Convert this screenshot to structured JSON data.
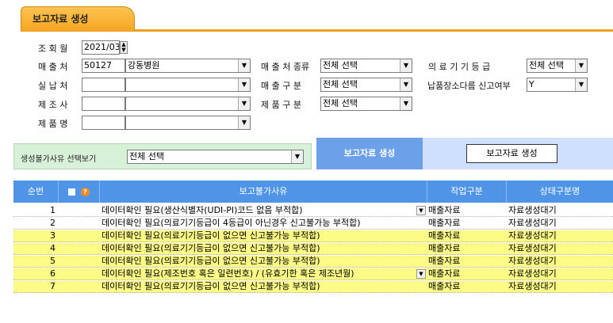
{
  "tab": {
    "title": "보고자료 생성"
  },
  "filters": {
    "period_label": "조 회 월",
    "period_value": "2021/03",
    "sales_label": "매 출 처",
    "sales_code": "50127",
    "sales_name": "강동병원",
    "sales_type_label": "매 출 처 종류",
    "sales_type_value": "전체 선택",
    "device_grade_label": "의 료 기 기 등 급",
    "device_grade_value": "전체 선택",
    "payer_label": "실 납 처",
    "payer_code": "",
    "payer_name": "",
    "sales_div_label": "매 출 구 분",
    "sales_div_value": "전체 선택",
    "report_flag_label": "납품장소다름 신고여부",
    "report_flag_value": "Y",
    "maker_label": "제 조 사",
    "maker_code": "",
    "maker_name": "",
    "product_div_label": "제 품 구 분",
    "product_div_value": "전체 선택",
    "product_label": "제 품 명",
    "product_code": "",
    "product_name": ""
  },
  "actions": {
    "reason_filter_label": "생성불가사유 선택보기",
    "reason_filter_value": "전체 선택",
    "report_section_label": "보고자료 생성",
    "generate_button": "보고자료 생성"
  },
  "grid": {
    "headers": {
      "no": "순번",
      "reason": "보고불가사유",
      "work": "작업구분",
      "status": "상태구분명"
    },
    "rows": [
      {
        "no": "1",
        "reason": "데이터확인 필요(생산식별자(UDI-PI)코드 없음 부적합)",
        "work": "매출자료",
        "status": "자료생성대기",
        "highlight": false,
        "dropdown": true
      },
      {
        "no": "2",
        "reason": "데이터확인 필요(의료기기등급이 4등급이 아닌경우 신고불가능 부적합)",
        "work": "매출자료",
        "status": "자료생성대기",
        "highlight": false,
        "dropdown": false
      },
      {
        "no": "3",
        "reason": "데이터확인 필요(의료기기등급이 없으면 신고불가능 부적합)",
        "work": "매출자료",
        "status": "자료생성대기",
        "highlight": true,
        "dropdown": false
      },
      {
        "no": "4",
        "reason": "데이터확인 필요(의료기기등급이 없으면 신고불가능 부적합)",
        "work": "매출자료",
        "status": "자료생성대기",
        "highlight": true,
        "dropdown": false
      },
      {
        "no": "5",
        "reason": "데이터확인 필요(의료기기등급이 없으면 신고불가능 부적합)",
        "work": "매출자료",
        "status": "자료생성대기",
        "highlight": true,
        "dropdown": false
      },
      {
        "no": "6",
        "reason": "데이터확인 필요(제조번호 혹은 일련번호) / (유효기한 혹은 제조년월)",
        "work": "매출자료",
        "status": "자료생성대기",
        "highlight": true,
        "dropdown": true
      },
      {
        "no": "7",
        "reason": "데이터확인 필요(의료기기등급이 없으면 신고불가능 부적합)",
        "work": "매출자료",
        "status": "자료생성대기",
        "highlight": true,
        "dropdown": false
      }
    ]
  },
  "colors": {
    "tab": "#f5a623",
    "header": "#4f94e6",
    "highlight": "#fbfb86",
    "green_bar": "#d7f0d8",
    "blue_bar": "#cfe0ff"
  }
}
